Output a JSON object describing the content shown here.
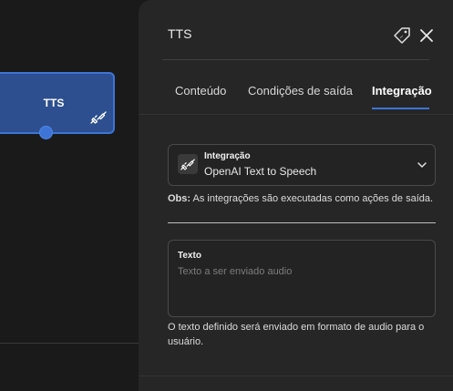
{
  "node": {
    "title": "TTS",
    "icon": "plug-icon"
  },
  "panel": {
    "title": "TTS",
    "icons": {
      "tag": "tag-icon",
      "close": "close-icon"
    },
    "tabs": [
      {
        "label": "Conteúdo"
      },
      {
        "label": "Condições de saída"
      },
      {
        "label": "Integração"
      }
    ],
    "active_tab": "Integração",
    "integration": {
      "label": "Integração",
      "value": "OpenAI Text to Speech",
      "icon": "plug-icon"
    },
    "obs": {
      "prefix": "Obs:",
      "text": " As integrações são executadas como ações de saída."
    },
    "text_field": {
      "label": "Texto",
      "placeholder": "Texto a ser enviado audio"
    },
    "helper": "O texto definido será enviado em formato de audio para o usuário."
  },
  "colors": {
    "accent": "#3d74d6",
    "node_fill": "#2d4f8f",
    "panel_bg": "#262626",
    "canvas_bg": "#1a1a1a"
  }
}
